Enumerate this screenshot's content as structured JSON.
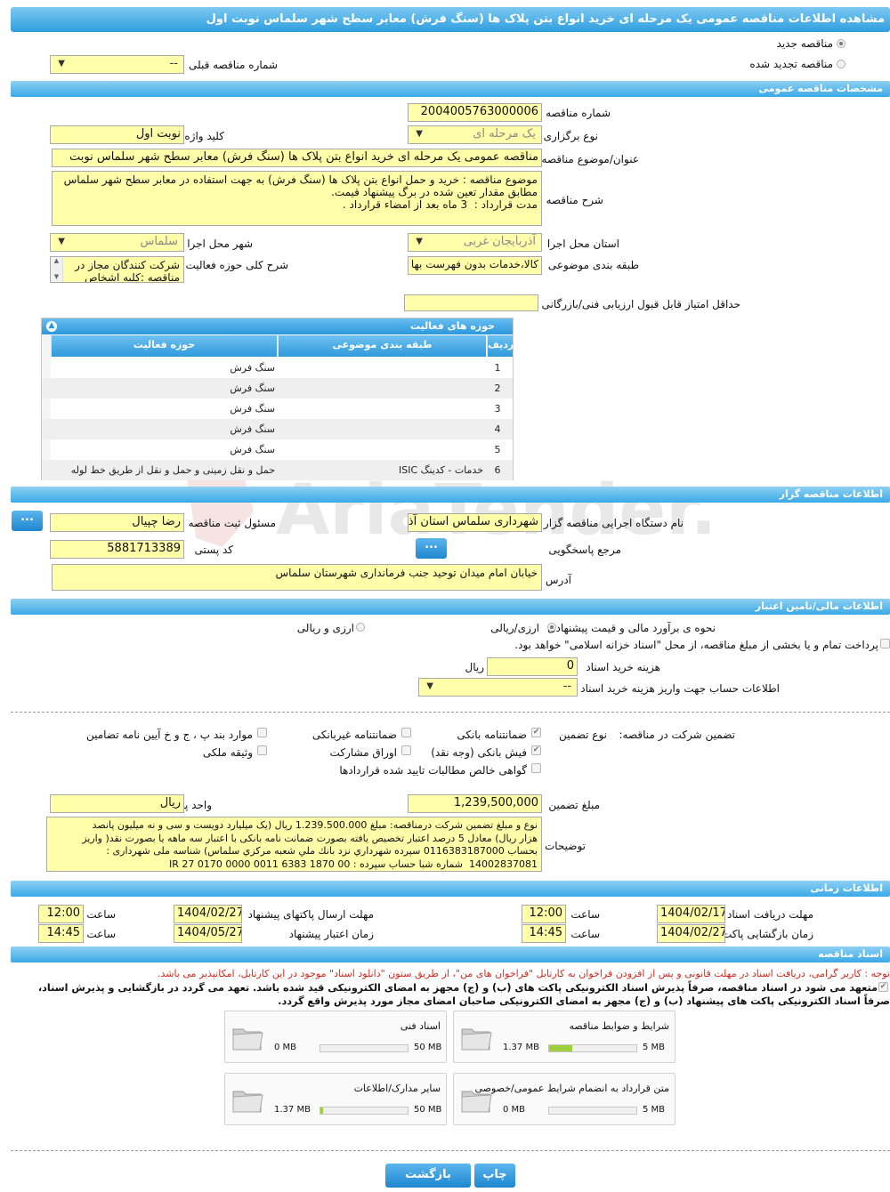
{
  "page_title": "مشاهده اطلاعات مناقصه عمومی یک مرحله ای خرید انواع بتن پلاک ها (سنگ فرش) معابر سطح شهر سلماس نوبت اول",
  "mode": {
    "new_tender": "مناقصه جدید",
    "renewed_tender": "مناقصه تجدید شده",
    "previous_tender_label": "شماره مناقصه قبلی",
    "previous_tender_value": "--"
  },
  "general": {
    "section_title": "مشخصات مناقصه عمومی",
    "tender_number_label": "شماره مناقصه",
    "tender_number": "2004005763000006",
    "holding_type_label": "نوع برگزاری",
    "holding_type": "یک مرحله ای",
    "keyword_label": "کلید واژه",
    "keyword": "نوبت اول",
    "subject_label": "عنوان/موضوع مناقصه",
    "subject": "مناقصه عمومی یک مرحله ای  خرید انواع بتن پلاک ها (سنگ فرش) معابر سطح شهر سلماس نوبت",
    "description_label": "شرح مناقصه",
    "description": "موضوع مناقصه : خرید و حمل انواع بتن پلاک ها (سنگ فرش) به جهت استفاده در معابر سطح شهر سلماس\nمطابق مقدار تعین شده در برگ پیشنهاد قیمت.\nمدت قرارداد :  3 ماه بعد از امضاء قرارداد .",
    "province_label": "استان محل اجرا",
    "province": "آذربایجان غربی",
    "city_label": "شهر محل اجرا",
    "city": "سلماس",
    "category_label": "طبقه بندی موضوعی",
    "category": "کالا،خدمات بدون فهرست بها",
    "activity_desc_label": "شرح کلی حوزه فعالیت",
    "activity_desc": "شرکت کنندگان مجاز در\nمناقصه :کلیه اشخاص",
    "min_score_label": "حداقل امتیاز قابل قبول ارزیابی فنی/بازرگانی",
    "min_score": ""
  },
  "activity_grid": {
    "title": "حوزه های فعالیت",
    "col_row": "ردیف",
    "col_category": "طبقه بندی موضوعی",
    "col_activity": "حوزه فعالیت",
    "rows": [
      {
        "n": "1",
        "category": "",
        "activity": "سنگ فرش"
      },
      {
        "n": "2",
        "category": "",
        "activity": "سنگ فرش"
      },
      {
        "n": "3",
        "category": "",
        "activity": "سنگ فرش"
      },
      {
        "n": "4",
        "category": "",
        "activity": "سنگ فرش"
      },
      {
        "n": "5",
        "category": "",
        "activity": "سنگ فرش"
      },
      {
        "n": "6",
        "category": "خدمات - کدینگ ISIC",
        "activity": "حمل و نقل زمینی و حمل و نقل از طریق خط لوله"
      }
    ]
  },
  "organizer": {
    "section_title": "اطلاعات مناقصه گزار",
    "org_label": "نام دستگاه اجرایی مناقصه گزار",
    "org": "شهرداری سلماس استان آذربایجان غربی",
    "registrar_label": "مسئول ثبت مناقصه",
    "registrar": "رضا چپیال",
    "reference_label": "مرجع پاسخگویی",
    "postal_label": "کد پستی",
    "postal": "5881713389",
    "address_label": "آدرس",
    "address": "خیابان امام میدان توحید جنب فرمانداری شهرستان سلماس",
    "more_button": "..."
  },
  "finance": {
    "section_title": "اطلاعات مالی/تامین اعتبار",
    "price_method_label": "نحوه ی برآورد مالی و قیمت پیشنهادی",
    "opt_rial": "ارزی/ریالی",
    "opt_fx": "ارزی و ریالی",
    "treasury_text": "پرداخت تمام و یا بخشی از مبلغ مناقصه، از محل \"اسناد خزانه اسلامی\" خواهد بود.",
    "doc_fee_label": "هزینه خرید اسناد",
    "doc_fee": "0",
    "doc_fee_unit": "ریال",
    "account_label": "اطلاعات حساب جهت واریز هزینه خرید اسناد",
    "account": "--"
  },
  "guarantee": {
    "title_label": "تضمین شرکت در مناقصه:",
    "type_label": "نوع تضمین",
    "bank_guarantee": "ضمانتنامه بانکی",
    "non_bank_guarantee": "ضمانتنامه غیربانکی",
    "clauses": "موارد بند پ ، ج و خ آیین نامه تضامین",
    "bank_receipt": "فیش بانکی (وجه نقد)",
    "bonds": "اوراق مشارکت",
    "property": "وثیقه ملکی",
    "net_claims": "گواهی خالص مطالبات تایید شده قراردادها",
    "amount_label": "مبلغ تضمین",
    "amount": "1,239,500,000",
    "currency_label": "واحد پول",
    "currency": "ریال",
    "notes_label": "توضیحات",
    "notes": "نوع و مبلغ تضمین شرکت درمناقصه: مبلغ 1.239.500.000 ریال (یک میلیارد دویست و سی و نه میلیون پانصد\nهزار ریال) معادل 5 درصد اعتبار تخصیص یافته بصورت ضمانت نامه بانکی با اعتبار سه ماهه یا بصورت نقد( واریز\nبحساب 0116383187000 سپرده شهرداري نزد بانك ملي شعبه مركزي سلماس) شناسه ملی شهرداری :\n14002837081  شماره شبا حساب سپرده : IR 27 0170 0000 0011 6383 1870 00"
  },
  "timing": {
    "section_title": "اطلاعات زمانی",
    "doc_receive_deadline_label": "مهلت دریافت اسناد",
    "doc_receive_date": "1404/02/17",
    "doc_receive_time": "12:00",
    "send_deadline_label": "مهلت ارسال پاکتهای پیشنهاد",
    "send_date": "1404/02/27",
    "send_time": "12:00",
    "opening_label": "زمان بازگشایی پاکت ها",
    "opening_date": "1404/02/27",
    "opening_time": "14:45",
    "validity_label": "زمان اعتبار پیشنهاد",
    "validity_date": "1404/05/27",
    "validity_time": "14:45",
    "time_label": "ساعت"
  },
  "documents": {
    "section_title": "اسناد مناقصه",
    "notice": "توجه : کاربر گرامی، دریافت اسناد در مهلت قانونی و پس از افزودن فراخوان به کارتابل \"فراخوان های من\"، از طریق ستون \"دانلود اسناد\" موجود در این کارتابل، امکانپذیر می باشد.",
    "pledge_line1": "متعهد می شود در اسناد مناقصه، صرفاً پذیرش اسناد الکترونیکی پاکت های (ب) و (ج) مجهز به امضای الکترونیکی قید شده باشد. تعهد می گردد در بازگشایی و پذیرش اسناد،",
    "pledge_line2": "صرفاً اسناد الکترونیکی پاکت های پیشنهاد (ب) و (ج) مجهز به امضای الکترونیکی صاحبان امضای مجاز مورد پذیرش واقع گردد.",
    "files": [
      {
        "name": "شرایط و ضوابط مناقصه",
        "min": "1.37 MB",
        "max": "5 MB",
        "fill": 0.27
      },
      {
        "name": "اسناد فنی",
        "min": "0 MB",
        "max": "50 MB",
        "fill": 0
      },
      {
        "name": "متن قرارداد به انضمام شرایط عمومی/خصوصی",
        "min": "0 MB",
        "max": "5 MB",
        "fill": 0
      },
      {
        "name": "سایر مدارک/اطلاعات",
        "min": "1.37 MB",
        "max": "50 MB",
        "fill": 0.03
      }
    ]
  },
  "footer": {
    "print_button": "چاپ",
    "back_button": "بازگشت"
  },
  "watermark": "AriaTender.neT",
  "colors": {
    "header_blue": "#3aa9e6",
    "field_yellow": "#ffffaa",
    "notice_red": "#d42a1e",
    "progress_green": "#9ccf3a"
  }
}
